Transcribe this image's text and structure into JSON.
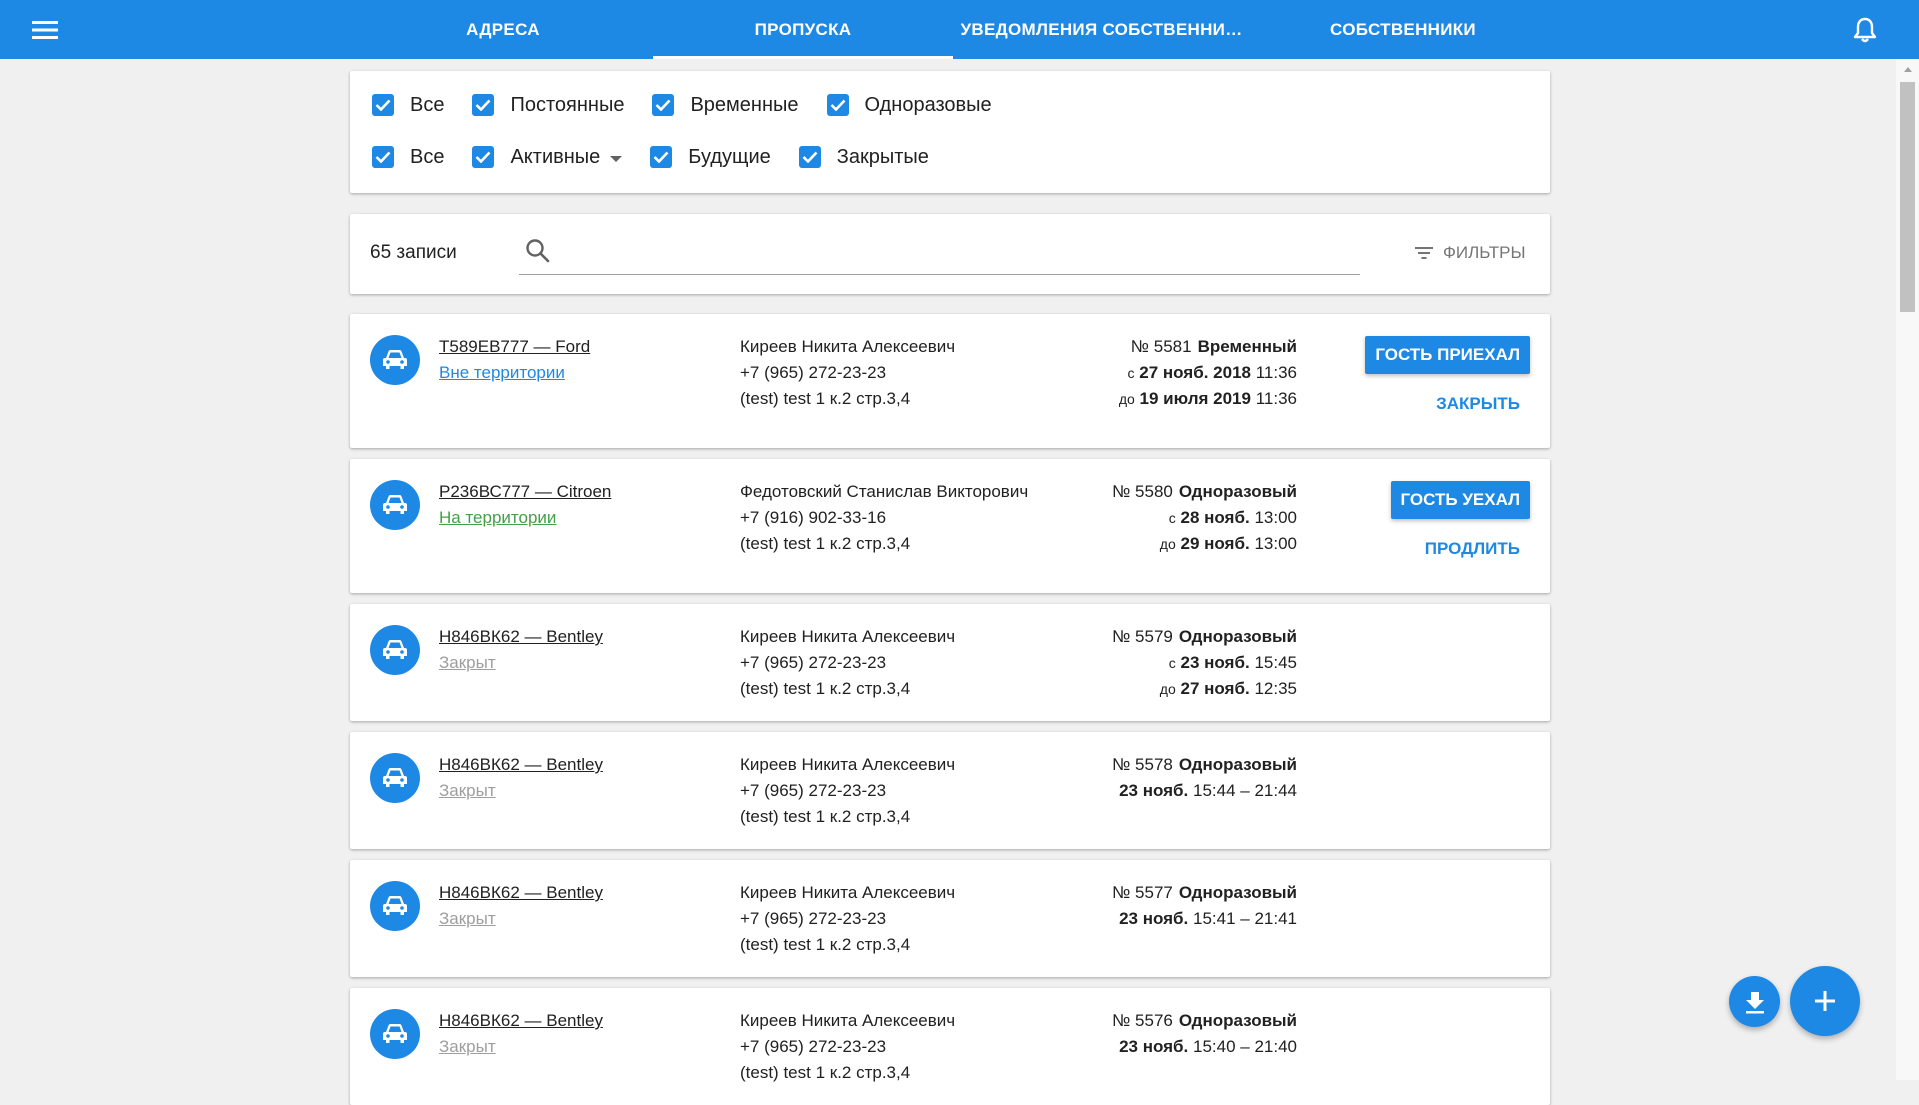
{
  "colors": {
    "primary": "#1e88e5",
    "status_outside": "#1e88e5",
    "status_inside": "#43a047",
    "status_closed": "#9e9e9e"
  },
  "appbar": {
    "menu_icon": "menu-icon",
    "tabs": [
      {
        "label": "АДРЕСА",
        "active": false
      },
      {
        "label": "ПРОПУСКА",
        "active": true
      },
      {
        "label": "УВЕДОМЛЕНИЯ СОБСТВЕННИК...",
        "active": false
      },
      {
        "label": "СОБСТВЕННИКИ",
        "active": false
      }
    ],
    "bell_icon": "bell-icon"
  },
  "filters": {
    "row1": [
      "Все",
      "Постоянные",
      "Временные",
      "Одноразовые"
    ],
    "row2": [
      "Все",
      "Активные",
      "Будущие",
      "Закрытые"
    ]
  },
  "search": {
    "count": "65 записи",
    "placeholder": "",
    "filters_label": "ФИЛЬТРЫ"
  },
  "passes": [
    {
      "plate": "Т589ЕВ777 — Ford",
      "status": "Вне территории",
      "status_kind": "outside",
      "owner": "Киреев Никита Алексеевич",
      "phone": "+7 (965) 272-23-23",
      "address": "(test) test 1 к.2 стр.3,4",
      "number": "№ 5581",
      "type": "Временный",
      "from_prefix": "с",
      "from_date": "27 нояб. 2018",
      "from_time": "11:36",
      "to_prefix": "до",
      "to_date": "19 июля 2019",
      "to_time": "11:36",
      "primary_action": "ГОСТЬ ПРИЕХАЛ",
      "secondary_action": "ЗАКРЫТЬ"
    },
    {
      "plate": "Р236ВС777 — Citroen",
      "status": "На территории",
      "status_kind": "inside",
      "owner": "Федотовский Станислав Викторович",
      "phone": "+7 (916) 902-33-16",
      "address": "(test) test 1 к.2 стр.3,4",
      "number": "№ 5580",
      "type": "Одноразовый",
      "from_prefix": "с",
      "from_date": "28 нояб.",
      "from_time": "13:00",
      "to_prefix": "до",
      "to_date": "29 нояб.",
      "to_time": "13:00",
      "primary_action": "ГОСТЬ УЕХАЛ",
      "secondary_action": "ПРОДЛИТЬ"
    },
    {
      "plate": "Н846ВК62 — Bentley",
      "status": "Закрыт",
      "status_kind": "closed",
      "owner": "Киреев Никита Алексеевич",
      "phone": "+7 (965) 272-23-23",
      "address": "(test) test 1 к.2 стр.3,4",
      "number": "№ 5579",
      "type": "Одноразовый",
      "from_prefix": "с",
      "from_date": "23 нояб.",
      "from_time": "15:45",
      "to_prefix": "до",
      "to_date": "27 нояб.",
      "to_time": "12:35"
    },
    {
      "plate": "Н846ВК62 — Bentley",
      "status": "Закрыт",
      "status_kind": "closed",
      "owner": "Киреев Никита Алексеевич",
      "phone": "+7 (965) 272-23-23",
      "address": "(test) test 1 к.2 стр.3,4",
      "number": "№ 5578",
      "type": "Одноразовый",
      "date": "23 нояб.",
      "time_range": "15:44 – 21:44"
    },
    {
      "plate": "Н846ВК62 — Bentley",
      "status": "Закрыт",
      "status_kind": "closed",
      "owner": "Киреев Никита Алексеевич",
      "phone": "+7 (965) 272-23-23",
      "address": "(test) test 1 к.2 стр.3,4",
      "number": "№ 5577",
      "type": "Одноразовый",
      "date": "23 нояб.",
      "time_range": "15:41 – 21:41"
    },
    {
      "plate": "Н846ВК62 — Bentley",
      "status": "Закрыт",
      "status_kind": "closed",
      "owner": "Киреев Никита Алексеевич",
      "phone": "+7 (965) 272-23-23",
      "address": "(test) test 1 к.2 стр.3,4",
      "number": "№ 5576",
      "type": "Одноразовый",
      "date": "23 нояб.",
      "time_range": "15:40 – 21:40"
    }
  ],
  "fabs": {
    "download_icon": "download-icon",
    "add_icon": "plus-icon"
  }
}
